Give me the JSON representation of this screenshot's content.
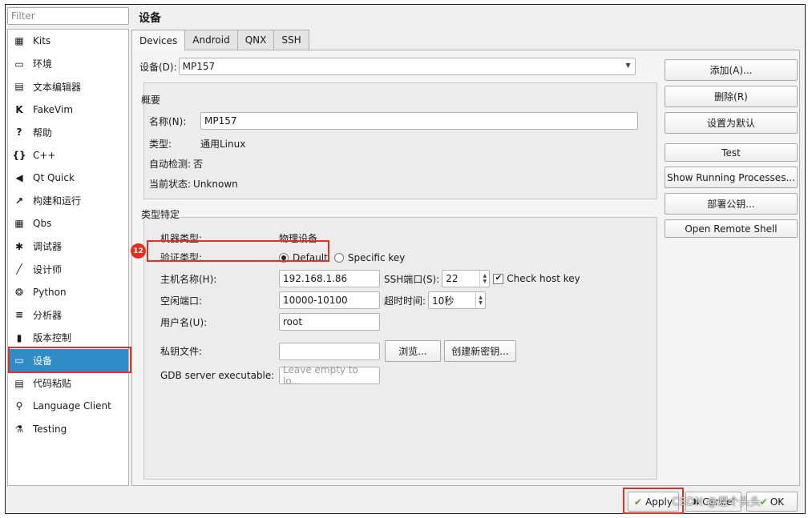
{
  "filter": {
    "placeholder": "Filter"
  },
  "sidebar": {
    "items": [
      {
        "label": "Kits",
        "icon": "kits-icon",
        "glyph": "▦"
      },
      {
        "label": "环境",
        "icon": "monitor-icon",
        "glyph": "▭"
      },
      {
        "label": "文本编辑器",
        "icon": "text-editor-icon",
        "glyph": "▤"
      },
      {
        "label": "FakeVim",
        "icon": "fakevim-icon",
        "glyph": "K"
      },
      {
        "label": "帮助",
        "icon": "help-icon",
        "glyph": "?"
      },
      {
        "label": "C++",
        "icon": "cpp-icon",
        "glyph": "{}"
      },
      {
        "label": "Qt Quick",
        "icon": "qt-quick-icon",
        "glyph": "◀"
      },
      {
        "label": "构建和运行",
        "icon": "build-run-icon",
        "glyph": "↗"
      },
      {
        "label": "Qbs",
        "icon": "qbs-icon",
        "glyph": "▦"
      },
      {
        "label": "调试器",
        "icon": "debugger-icon",
        "glyph": "✱"
      },
      {
        "label": "设计师",
        "icon": "designer-icon",
        "glyph": "╱"
      },
      {
        "label": "Python",
        "icon": "python-icon",
        "glyph": "❂"
      },
      {
        "label": "分析器",
        "icon": "analyzer-icon",
        "glyph": "≡"
      },
      {
        "label": "版本控制",
        "icon": "version-control-icon",
        "glyph": "▮"
      },
      {
        "label": "设备",
        "icon": "devices-icon",
        "glyph": "▭",
        "selected": true
      },
      {
        "label": "代码粘贴",
        "icon": "code-paste-icon",
        "glyph": "▤"
      },
      {
        "label": "Language Client",
        "icon": "language-client-icon",
        "glyph": "⚲"
      },
      {
        "label": "Testing",
        "icon": "testing-icon",
        "glyph": "⚗"
      }
    ]
  },
  "header": {
    "title": "设备"
  },
  "tabs": [
    {
      "label": "Devices",
      "active": true
    },
    {
      "label": "Android"
    },
    {
      "label": "QNX"
    },
    {
      "label": "SSH"
    }
  ],
  "device": {
    "label": "设备(D):",
    "value": "MP157"
  },
  "summary": {
    "title": "概要",
    "name_label": "名称(N):",
    "name_value": "MP157",
    "type_label": "类型:",
    "type_value": "通用Linux",
    "autodetect_label": "自动检测:",
    "autodetect_value": "否",
    "state_label": "当前状态:",
    "state_value": "Unknown"
  },
  "specific": {
    "title": "类型特定",
    "machine_type_label": "机器类型:",
    "machine_type_value": "物理设备",
    "auth_label": "验证类型:",
    "auth_default": "Default",
    "auth_specific": "Specific key",
    "host_label": "主机名称(H):",
    "host_value": "192.168.1.86",
    "ssh_port_label": "SSH端口(S):",
    "ssh_port_value": "22",
    "check_host_key": "Check host key",
    "free_ports_label": "空闲端口:",
    "free_ports_value": "10000-10100",
    "timeout_label": "超时时间:",
    "timeout_value": "10秒",
    "user_label": "用户名(U):",
    "user_value": "root",
    "key_label": "私钥文件:",
    "key_value": "",
    "browse": "浏览...",
    "create_key": "创建新密钥...",
    "gdb_label": "GDB server executable:",
    "gdb_placeholder": "Leave empty to lo..."
  },
  "buttons": {
    "add": "添加(A)...",
    "remove": "删除(R)",
    "set_default": "设置为默认",
    "test": "Test",
    "show_processes": "Show Running Processes...",
    "deploy_key": "部署公钥...",
    "remote_shell": "Open Remote Shell"
  },
  "annotation": {
    "badge": "12"
  },
  "footer": {
    "apply": "Apply",
    "cancel": "Cancel",
    "ok": "OK"
  },
  "watermark": "CSDN @煜个头头",
  "colors": {
    "selection": "#308cc6",
    "highlight": "#d9342b"
  }
}
